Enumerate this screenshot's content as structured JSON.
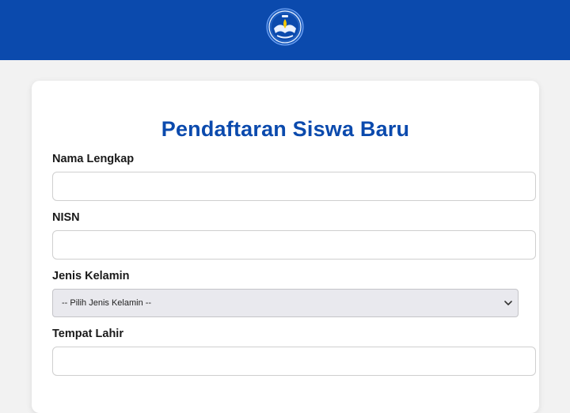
{
  "header": {
    "logo_icon": "tut-wuri-handayani-logo",
    "background_color": "#0b4aad"
  },
  "form": {
    "title": "Pendaftaran Siswa Baru",
    "fields": [
      {
        "label": "Nama Lengkap",
        "value": ""
      },
      {
        "label": "NISN",
        "value": ""
      },
      {
        "label": "Jenis Kelamin",
        "selected": "-- Pilih Jenis Kelamin --"
      },
      {
        "label": "Tempat Lahir",
        "value": ""
      }
    ]
  },
  "colors": {
    "accent": "#0b4aad",
    "page_background": "#f2f2f2",
    "card_background": "#ffffff"
  }
}
